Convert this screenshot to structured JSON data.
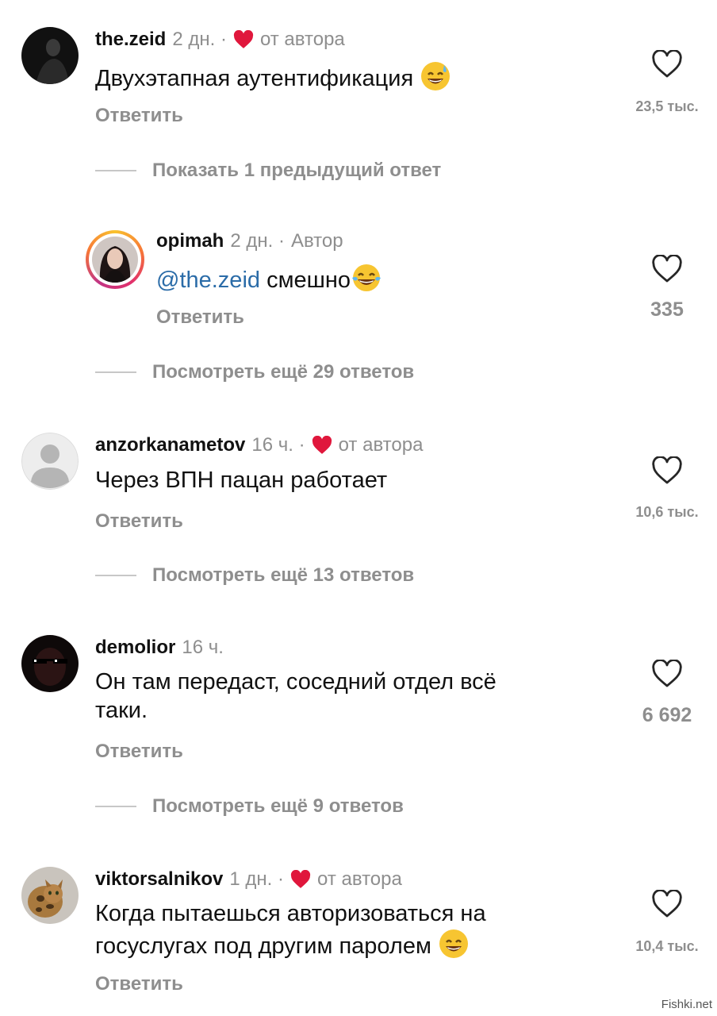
{
  "colors": {
    "like_red": "#e0173c",
    "meta_gray": "#8e8e8e",
    "mention_blue": "#2b6ca8"
  },
  "comments": [
    {
      "username": "the.zeid",
      "time": "2 дн. ·",
      "badge": "от автора",
      "text": "Двухэтапная аутентификация",
      "emoji": "sweat-smile-emoji",
      "reply": "Ответить",
      "likes": "23,5 тыс.",
      "thread_link": "Показать 1 предыдущий ответ"
    },
    {
      "username": "opimah",
      "time": "2 дн. ·",
      "badge": "Автор",
      "mention": "@the.zeid",
      "text": "смешно",
      "emoji": "tears-of-joy-emoji",
      "reply": "Ответить",
      "likes": "335",
      "thread_link": "Посмотреть ещё 29 ответов"
    },
    {
      "username": "anzorkanametov",
      "time": "16 ч. ·",
      "badge": "от автора",
      "text": "Через ВПН пацан работает",
      "reply": "Ответить",
      "likes": "10,6 тыс.",
      "thread_link": "Посмотреть ещё 13 ответов"
    },
    {
      "username": "demolior",
      "time": "16 ч.",
      "text_line1": "Он там передаст, соседний отдел всё",
      "text_line2": "таки.",
      "reply": "Ответить",
      "likes": "6 692",
      "thread_link": "Посмотреть ещё 9 ответов"
    },
    {
      "username": "viktorsalnikov",
      "time": "1 дн. ·",
      "badge": "от автора",
      "text_line1": "Когда пытаешься авторизоваться на",
      "text_line2": "госуслугах под другим паролем",
      "emoji": "grin-emoji",
      "reply": "Ответить",
      "likes": "10,4 тыс."
    }
  ],
  "watermark": "Fishki.net"
}
